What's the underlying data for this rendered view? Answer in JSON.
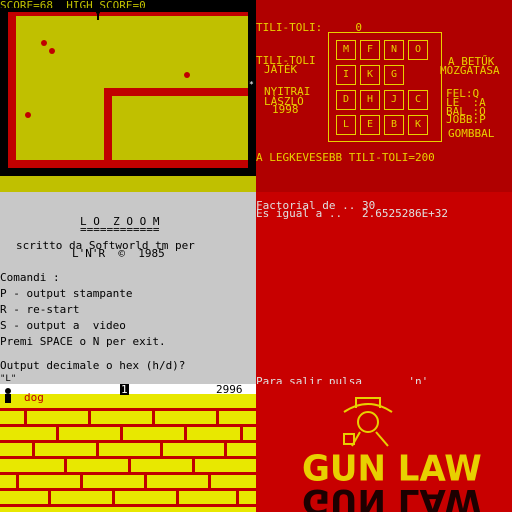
{
  "colors": {
    "yellow": "#c0c000",
    "red": "#c00000",
    "black": "#000000",
    "brightYellow": "#e8e800",
    "grey": "#c8c8c8",
    "white": "#e0e0e0"
  },
  "maze": {
    "score_line": "SCORE=68  HIGH SCORE=0",
    "player_icon": "man-icon",
    "enemy_icon": "spider-icon"
  },
  "tilitoli": {
    "header": "TILI-TOLI:     0",
    "title1": "TILI-TOLI",
    "title2": "JÁTÉK",
    "author1": "NYITRAI",
    "author2": "LÁSZLÓ",
    "year": "1998",
    "right1": "A BETŰK",
    "right2": "MOZGATÁSA",
    "controls": [
      {
        "label": "FEL",
        "key": ":Q"
      },
      {
        "label": "LE",
        "key": ":A"
      },
      {
        "label": "BAL",
        "key": ":O"
      },
      {
        "label": "JOBB",
        "key": ":P"
      }
    ],
    "right_bottom": "GOMBBAL",
    "grid": [
      [
        "M",
        "F",
        "N",
        "O"
      ],
      [
        "I",
        "K",
        "G",
        ""
      ],
      [
        "D",
        "H",
        "J",
        "C"
      ],
      [
        "L",
        "E",
        "B",
        "K"
      ]
    ],
    "footer": "A LEGKEVESEBB TILI-TOLI=200"
  },
  "lozoom": {
    "title": "L O  Z O O M",
    "underline": "============",
    "line1": "scritto da Softworld tm per",
    "line2": "L'N'R  ©  1985",
    "commands_title": "Comandi :",
    "cmds": [
      "P - output stampante",
      "R - re-start",
      "S - output a  video"
    ],
    "exit": "Premi SPACE o N per exit.",
    "prompt": "Output decimale o hex (h/d)?",
    "last": "\"L\""
  },
  "factorial": {
    "line1": "Factorial de .. 30",
    "line2": "Es igual a ..   2.6525286E+32",
    "bottom": "Para salir pulsa       'n'"
  },
  "dog": {
    "label": "dog",
    "lives": "1",
    "score": "2996",
    "player_icon": "man-icon"
  },
  "gunlaw": {
    "title": "GUN LAW",
    "reflection": "GUN LAW",
    "cowboy_icon": "cowboy-icon"
  }
}
